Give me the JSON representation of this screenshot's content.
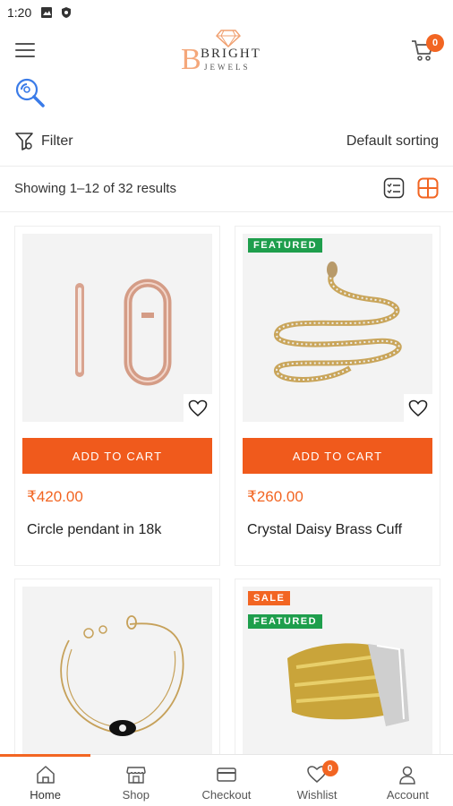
{
  "status_bar": {
    "time": "1:20"
  },
  "header": {
    "logo_top": "BRIGHT",
    "logo_bottom": "JEWELS",
    "logo_initial": "B",
    "cart_count": "0"
  },
  "toolbar": {
    "filter_label": "Filter",
    "sorting_label": "Default sorting",
    "results_text": "Showing 1–12 of 32 results"
  },
  "products": [
    {
      "price": "₹420.00",
      "name": "Circle pendant in 18k",
      "badges": [],
      "add_label": "ADD TO CART"
    },
    {
      "price": "₹260.00",
      "name": "Crystal Daisy Brass Cuff",
      "badges": [
        "FEATURED"
      ],
      "add_label": "ADD TO CART"
    },
    {
      "badges": []
    },
    {
      "badges": [
        "SALE",
        "FEATURED"
      ]
    }
  ],
  "bottom_nav": [
    {
      "label": "Home",
      "icon": "home-icon"
    },
    {
      "label": "Shop",
      "icon": "shop-icon"
    },
    {
      "label": "Checkout",
      "icon": "checkout-icon"
    },
    {
      "label": "Wishlist",
      "icon": "heart-icon",
      "badge": "0"
    },
    {
      "label": "Account",
      "icon": "account-icon"
    }
  ],
  "colors": {
    "accent": "#f26522",
    "featured": "#1e9e4c",
    "button": "#f05a1c"
  }
}
